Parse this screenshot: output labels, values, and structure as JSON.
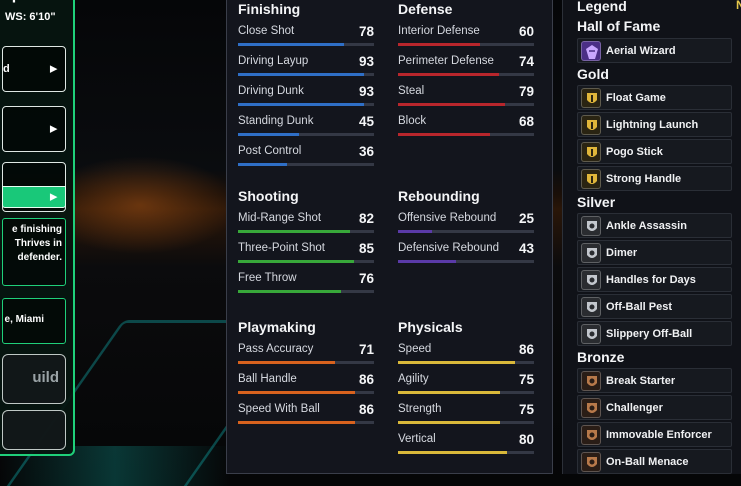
{
  "left_panel": {
    "title": "nplate",
    "ws_label": "WS:",
    "ws_value": "6'10\"",
    "cards": [
      {
        "value": "d",
        "arrow": "▶"
      },
      {
        "value": "",
        "arrow": "▶"
      },
      {
        "value": "",
        "arrow": "▶"
      }
    ],
    "description_lines": [
      "e finishing",
      "Thrives in",
      "defender."
    ],
    "location": "e, Miami",
    "build_button": "uild"
  },
  "attributes": {
    "finishing": {
      "title": "Finishing",
      "stats": [
        {
          "name": "Close Shot",
          "value": 78
        },
        {
          "name": "Driving Layup",
          "value": 93
        },
        {
          "name": "Driving Dunk",
          "value": 93
        },
        {
          "name": "Standing Dunk",
          "value": 45
        },
        {
          "name": "Post Control",
          "value": 36
        }
      ]
    },
    "defense": {
      "title": "Defense",
      "stats": [
        {
          "name": "Interior Defense",
          "value": 60
        },
        {
          "name": "Perimeter Defense",
          "value": 74
        },
        {
          "name": "Steal",
          "value": 79
        },
        {
          "name": "Block",
          "value": 68
        }
      ]
    },
    "shooting": {
      "title": "Shooting",
      "stats": [
        {
          "name": "Mid-Range Shot",
          "value": 82
        },
        {
          "name": "Three-Point Shot",
          "value": 85
        },
        {
          "name": "Free Throw",
          "value": 76
        }
      ]
    },
    "rebounding": {
      "title": "Rebounding",
      "stats": [
        {
          "name": "Offensive Rebound",
          "value": 25
        },
        {
          "name": "Defensive Rebound",
          "value": 43
        }
      ]
    },
    "playmaking": {
      "title": "Playmaking",
      "stats": [
        {
          "name": "Pass Accuracy",
          "value": 71
        },
        {
          "name": "Ball Handle",
          "value": 86
        },
        {
          "name": "Speed With Ball",
          "value": 86
        }
      ]
    },
    "physicals": {
      "title": "Physicals",
      "stats": [
        {
          "name": "Speed",
          "value": 86
        },
        {
          "name": "Agility",
          "value": 75
        },
        {
          "name": "Strength",
          "value": 75
        },
        {
          "name": "Vertical",
          "value": 80
        }
      ]
    }
  },
  "badges": {
    "header": "Legend",
    "header_right": "N",
    "hall_of_fame": {
      "title": "Hall of Fame",
      "items": [
        "Aerial Wizard"
      ]
    },
    "gold": {
      "title": "Gold",
      "items": [
        "Float Game",
        "Lightning Launch",
        "Pogo Stick",
        "Strong Handle"
      ]
    },
    "silver": {
      "title": "Silver",
      "items": [
        "Ankle Assassin",
        "Dimer",
        "Handles for Days",
        "Off-Ball Pest",
        "Slippery Off-Ball"
      ]
    },
    "bronze": {
      "title": "Bronze",
      "items": [
        "Break Starter",
        "Challenger",
        "Immovable Enforcer",
        "On-Ball Menace"
      ]
    }
  },
  "colors": {
    "finishing": "#2f6fc7",
    "defense": "#b8262c",
    "shooting": "#38a83a",
    "rebounding": "#5a3aa8",
    "playmaking": "#d8621e",
    "physicals": "#d9b83a",
    "accent_green": "#1fd07a"
  }
}
